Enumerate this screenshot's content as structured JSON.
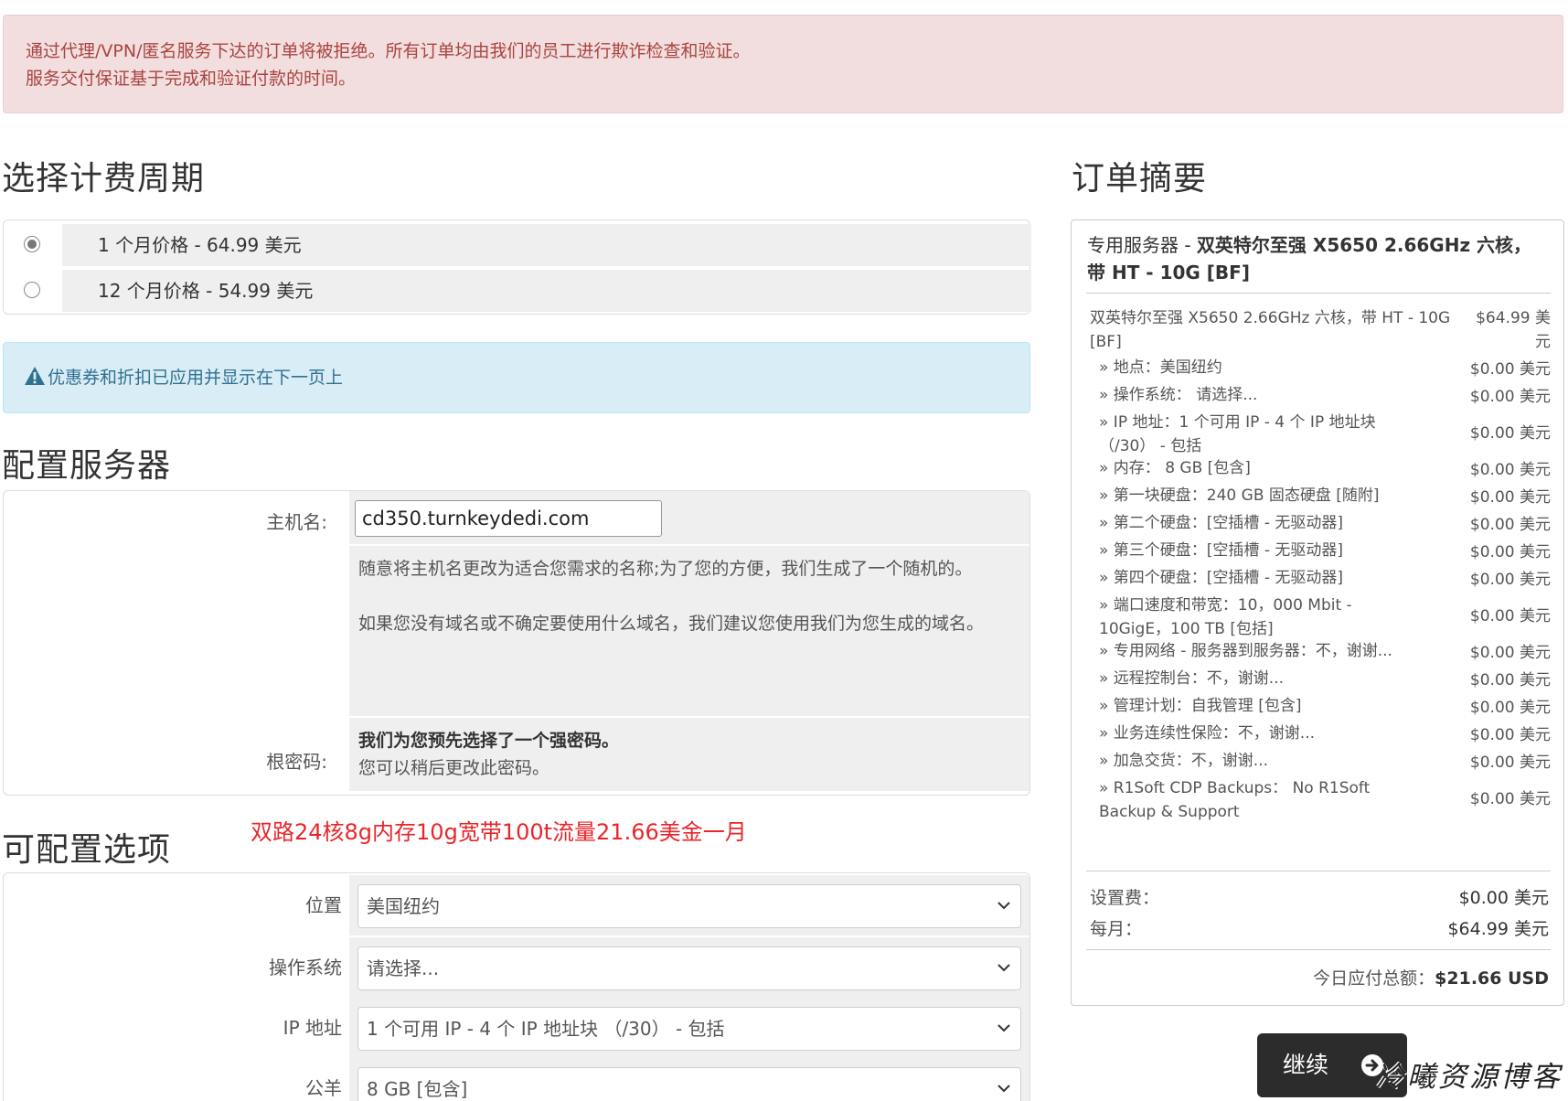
{
  "alert": {
    "line1": "通过代理/VPN/匿名服务下达的订单将被拒绝。所有订单均由我们的员工进行欺诈检查和验证。",
    "line2": "服务交付保证基于完成和验证付款的时间。"
  },
  "billing": {
    "heading": "选择计费周期",
    "options": [
      {
        "label": "1 个月价格 - 64.99 美元",
        "checked": true
      },
      {
        "label": "12 个月价格 - 54.99 美元",
        "checked": false
      }
    ]
  },
  "promo_notice": "优惠券和折扣已应用并显示在下一页上",
  "configure": {
    "heading": "配置服务器",
    "hostname_label": "主机名:",
    "hostname_value": "cd350.turnkeydedi.com",
    "hostname_help1": "随意将主机名更改为适合您需求的名称;为了您的方便，我们生成了一个随机的。",
    "hostname_help2": "如果您没有域名或不确定要使用什么域名，我们建议您使用我们为您生成的域名。",
    "root_label": "根密码:",
    "root_bold": "我们为您预先选择了一个强密码。",
    "root_help": "您可以稍后更改此密码。"
  },
  "annotation": "双路24核8g内存10g宽带100t流量21.66美金一月",
  "options": {
    "heading": "可配置选项",
    "rows": [
      {
        "label": "位置",
        "value": "美国纽约"
      },
      {
        "label": "操作系统",
        "value": "请选择..."
      },
      {
        "label": "IP 地址",
        "value": "1 个可用 IP - 4 个 IP 地址块 （/30） - 包括"
      },
      {
        "label": "公羊",
        "value": "8 GB [包含]"
      }
    ]
  },
  "summary": {
    "heading": "订单摘要",
    "product_prefix": "专用服务器 - ",
    "product_name": "双英特尔至强 X5650 2.66GHz 六核，带 HT - 10G [BF]",
    "base_desc": "双英特尔至强 X5650 2.66GHz 六核，带 HT - 10G [BF]",
    "base_amt": "$64.99 美元",
    "lines": [
      {
        "desc": "» 地点：美国纽约",
        "amt": "$0.00 美元"
      },
      {
        "desc": "» 操作系统： 请选择...",
        "amt": "$0.00 美元"
      },
      {
        "desc": "» IP 地址：1 个可用 IP - 4 个 IP 地址块 （/30） - 包括",
        "amt": "$0.00 美元"
      },
      {
        "desc": "» 内存： 8 GB [包含]",
        "amt": "$0.00 美元"
      },
      {
        "desc": "» 第一块硬盘：240 GB 固态硬盘 [随附]",
        "amt": "$0.00 美元"
      },
      {
        "desc": "» 第二个硬盘：[空插槽 - 无驱动器]",
        "amt": "$0.00 美元"
      },
      {
        "desc": "» 第三个硬盘：[空插槽 - 无驱动器]",
        "amt": "$0.00 美元"
      },
      {
        "desc": "» 第四个硬盘：[空插槽 - 无驱动器]",
        "amt": "$0.00 美元"
      },
      {
        "desc": "» 端口速度和带宽：10，000 Mbit - 10GigE，100 TB [包括]",
        "amt": "$0.00 美元"
      },
      {
        "desc": "» 专用网络 - 服务器到服务器：不，谢谢...",
        "amt": "$0.00 美元"
      },
      {
        "desc": "» 远程控制台：不，谢谢...",
        "amt": "$0.00 美元"
      },
      {
        "desc": "» 管理计划：自我管理 [包含]",
        "amt": "$0.00 美元"
      },
      {
        "desc": "» 业务连续性保险：不，谢谢...",
        "amt": "$0.00 美元"
      },
      {
        "desc": "» 加急交货：不，谢谢...",
        "amt": "$0.00 美元"
      },
      {
        "desc": "» R1Soft CDP Backups： No R1Soft Backup & Support",
        "amt": "$0.00 美元"
      }
    ],
    "setup_label": "设置费：",
    "setup_amt": "$0.00 美元",
    "monthly_label": "每月：",
    "monthly_amt": "$64.99 美元",
    "today_label": "今日应付总额：",
    "today_amt": "$21.66 USD"
  },
  "continue_label": "继续",
  "watermark": "冷曦资源博客",
  "colors": {
    "danger_bg": "#f2dede",
    "danger_text": "#a94442",
    "info_bg": "#d9edf7",
    "info_text": "#31708f",
    "annotation": "#e8262a",
    "button": "#2c2c2c"
  }
}
